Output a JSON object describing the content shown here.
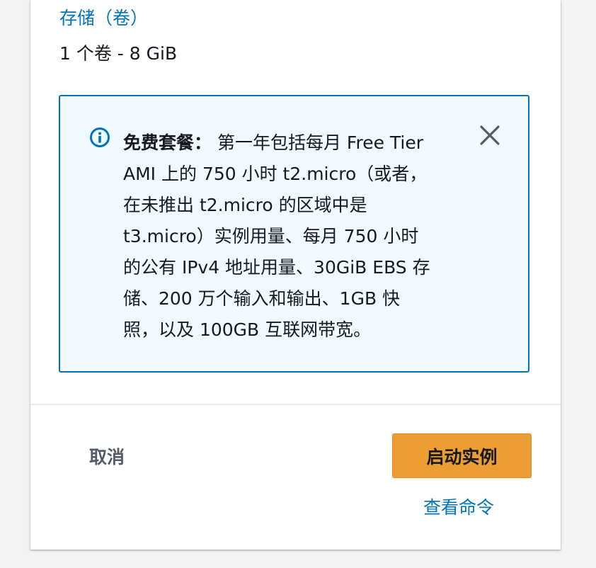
{
  "storage": {
    "title": "存储（卷）",
    "value": "1 个卷 - 8 GiB"
  },
  "info_alert": {
    "icon": "info-icon",
    "label": "免费套餐：",
    "lines": [
      " 第一年包括每月 Free Tier",
      "AMI 上的 750 小时 t2.micro（或者，",
      "在未推出 t2.micro 的区域中是",
      "t3.micro）实例用量、每月 750 小时",
      "的公有 IPv4 地址用量、30GiB EBS 存",
      "储、200 万个输入和输出、1GB 快",
      "照，以及 100GB 互联网带宽。"
    ],
    "close_icon": "close-icon"
  },
  "footer": {
    "cancel_label": "取消",
    "launch_label": "启动实例",
    "view_commands_label": "查看命令"
  },
  "colors": {
    "link": "#0073bb",
    "info_bg": "#f1faff",
    "info_border": "#0073bb",
    "primary_button": "#ec9d34"
  }
}
